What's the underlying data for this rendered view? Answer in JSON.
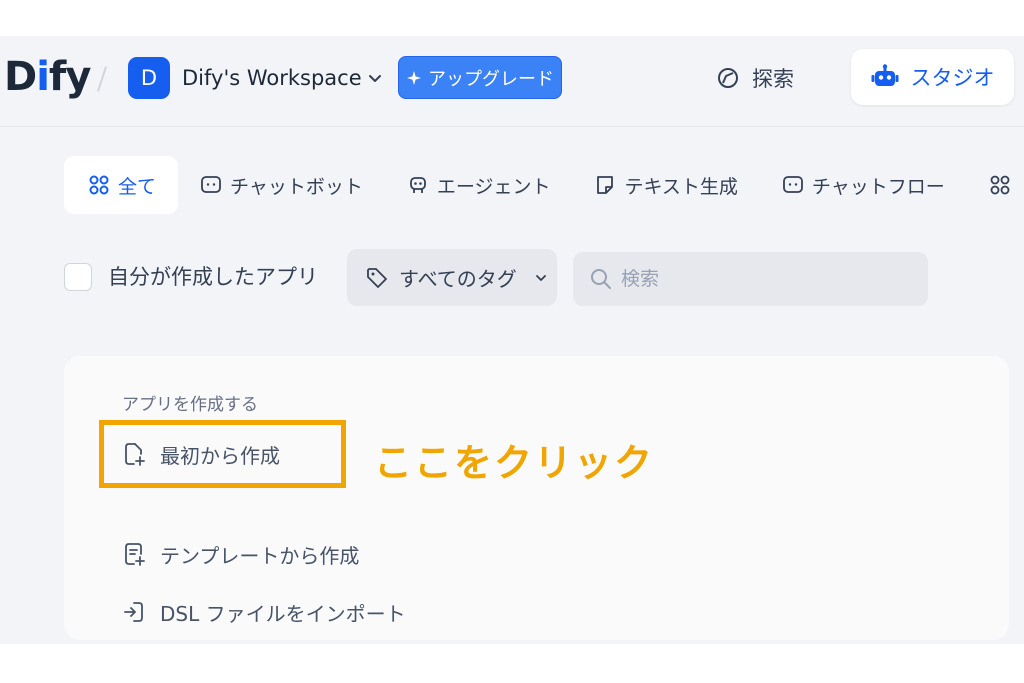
{
  "header": {
    "logo": "Dify",
    "workspace_initial": "D",
    "workspace_name": "Dify's Workspace",
    "upgrade_label": "アップグレード",
    "explore_label": "探索",
    "studio_label": "スタジオ"
  },
  "tabs": [
    {
      "label": "全て",
      "icon": "grid-icon",
      "active": true
    },
    {
      "label": "チャットボット",
      "icon": "chat-bubble-icon"
    },
    {
      "label": "エージェント",
      "icon": "robot-icon"
    },
    {
      "label": "テキスト生成",
      "icon": "note-icon"
    },
    {
      "label": "チャットフロー",
      "icon": "chat-flow-icon"
    }
  ],
  "filters": {
    "mine_label": "自分が作成したアプリ",
    "tags_label": "すべてのタグ",
    "search_placeholder": "検索"
  },
  "create": {
    "title": "アプリを作成する",
    "items": [
      {
        "label": "最初から作成",
        "icon": "new-file-icon"
      },
      {
        "label": "テンプレートから作成",
        "icon": "template-icon"
      },
      {
        "label": "DSL ファイルをインポート",
        "icon": "import-icon"
      }
    ]
  },
  "annotation": {
    "text": "ここをクリック",
    "color": "#f0a500"
  },
  "colors": {
    "accent": "#155eef",
    "upgrade": "#3b82f6",
    "background": "#f2f4f7"
  }
}
